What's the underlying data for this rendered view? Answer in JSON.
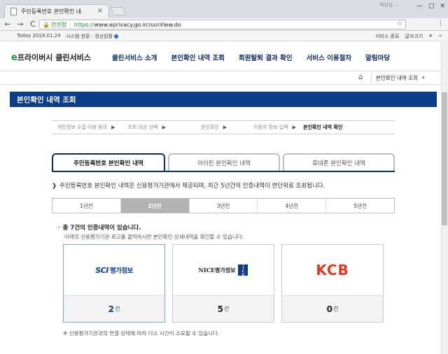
{
  "browser": {
    "tab_title": "주민등록번호 본인확인 내",
    "tab_close": "×",
    "user_chip": "세상님 ...",
    "win_min": "—",
    "win_max": "□",
    "win_close": "✕",
    "back": "←",
    "forward": "→",
    "reload": "C",
    "secure_label": "안전함",
    "url_scheme": "https://",
    "url_rest": "www.eprivacy.go.kr/ssnView.do",
    "bookmark": "☆",
    "menu": "⋮"
  },
  "util": {
    "today": "Today 2018.01.24",
    "status": "시스템 현황 : 정상원활",
    "end_service": "서비스 종료",
    "font_size": "글자크기",
    "plus": "+",
    "minus": "−"
  },
  "header": {
    "logo_e": "e",
    "logo_text": "프라이버시 클린서비스",
    "nav": [
      "클린서비스 소개",
      "본인확인 내역 조회",
      "회원탈퇴 결과 확인",
      "서비스 이용절차",
      "알림마당"
    ]
  },
  "crumb": {
    "home": "⌂",
    "current": "본인확인 내역 조회",
    "chev": "▾"
  },
  "title": "본인확인 내역 조회",
  "steps": [
    {
      "label": "개인정보 수집·이용 동의",
      "active": false
    },
    {
      "label": "조회 대상 선택",
      "active": false
    },
    {
      "label": "본인확인",
      "active": false
    },
    {
      "label": "이용자 정보 입력",
      "active": false
    },
    {
      "label": "본인확인 내역 확인",
      "active": true
    }
  ],
  "step_arrow": "▶",
  "content_tabs": [
    "주민등록번호 본인확인 내역",
    "아이핀 본인확인 내역",
    "휴대폰 본인확인 내역"
  ],
  "notice": {
    "chev": "❯",
    "text": "주민등록번호 본인확인 내역은 신용평가기관에서 제공되며, 최근 5년간의 인증내역이 연단위로 조회됩니다."
  },
  "years": [
    "1년전",
    "2년전",
    "3년전",
    "4년전",
    "5년전"
  ],
  "active_year_index": 1,
  "summary": {
    "hand": "☞",
    "prefix": "총 ",
    "count": "7",
    "suffix": "건의 인증내역이 있습니다.",
    "desc": "아래의 신용평가기관 로고를 클릭하시면 본인확인 상세내역을 확인할 수 있습니다."
  },
  "agencies": [
    {
      "logo_main": "SCI",
      "logo_sub": "평가정보",
      "count": "2",
      "unit": "건"
    },
    {
      "logo_main": "NICE평가정보",
      "logo_box": [
        "N",
        "I",
        "C",
        "E"
      ],
      "count": "5",
      "unit": "건"
    },
    {
      "logo_main": "KCB",
      "count": "0",
      "unit": "건"
    }
  ],
  "footnote": "※ 신용평가기관과의 연결 상태에 따라 다소 시간이 소요될 수 있습니다."
}
